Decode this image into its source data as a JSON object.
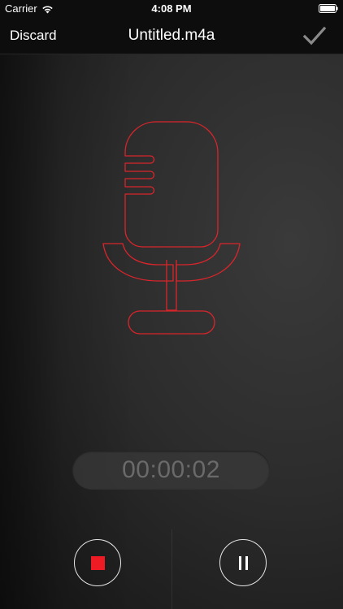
{
  "status_bar": {
    "carrier": "Carrier",
    "time": "4:08 PM",
    "wifi_icon": "wifi-icon",
    "battery_icon": "battery-icon"
  },
  "nav": {
    "discard_label": "Discard",
    "title": "Untitled.m4a",
    "save_icon": "checkmark-icon"
  },
  "mic": {
    "icon": "microphone-icon",
    "stroke_color": "#d9252b"
  },
  "timer": {
    "value": "00:00:02"
  },
  "controls": {
    "stop_icon": "stop-icon",
    "stop_color": "#ee1b24",
    "pause_icon": "pause-icon"
  }
}
